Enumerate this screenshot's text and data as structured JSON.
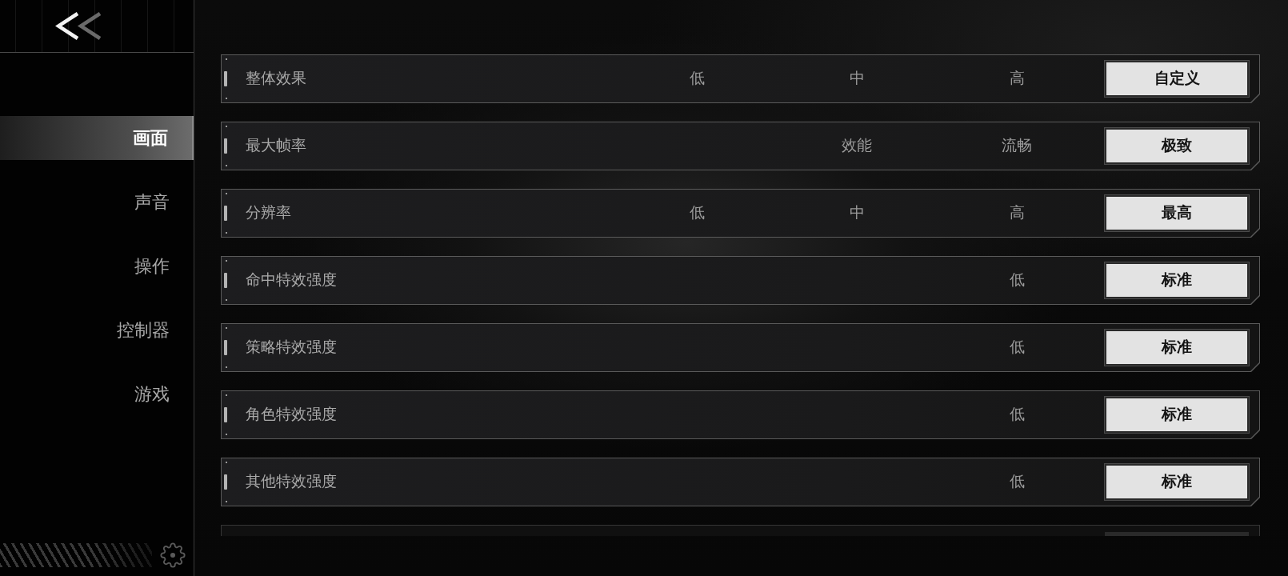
{
  "sidebar": {
    "items": [
      {
        "label": "画面",
        "selected": true
      },
      {
        "label": "声音",
        "selected": false
      },
      {
        "label": "操作",
        "selected": false
      },
      {
        "label": "控制器",
        "selected": false
      },
      {
        "label": "游戏",
        "selected": false
      }
    ]
  },
  "settings": [
    {
      "label": "整体效果",
      "options": [
        {
          "label": "低",
          "selected": false
        },
        {
          "label": "中",
          "selected": false
        },
        {
          "label": "高",
          "selected": false
        },
        {
          "label": "自定义",
          "selected": true
        }
      ]
    },
    {
      "label": "最大帧率",
      "options": [
        {
          "label": "效能",
          "selected": false
        },
        {
          "label": "流畅",
          "selected": false
        },
        {
          "label": "极致",
          "selected": true
        }
      ]
    },
    {
      "label": "分辨率",
      "options": [
        {
          "label": "低",
          "selected": false
        },
        {
          "label": "中",
          "selected": false
        },
        {
          "label": "高",
          "selected": false
        },
        {
          "label": "最高",
          "selected": true
        }
      ]
    },
    {
      "label": "命中特效强度",
      "options": [
        {
          "label": "低",
          "selected": false
        },
        {
          "label": "标准",
          "selected": true
        }
      ]
    },
    {
      "label": "策略特效强度",
      "options": [
        {
          "label": "低",
          "selected": false
        },
        {
          "label": "标准",
          "selected": true
        }
      ]
    },
    {
      "label": "角色特效强度",
      "options": [
        {
          "label": "低",
          "selected": false
        },
        {
          "label": "标准",
          "selected": true
        }
      ]
    },
    {
      "label": "其他特效强度",
      "options": [
        {
          "label": "低",
          "selected": false
        },
        {
          "label": "标准",
          "selected": true
        }
      ]
    }
  ]
}
